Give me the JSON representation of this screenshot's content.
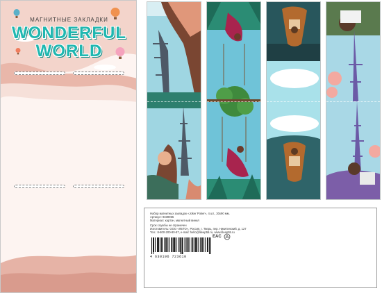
{
  "card": {
    "subtitle": "МАГНИТНЫЕ ЗАКЛАДКИ",
    "title_line1": "WONDERFUL",
    "title_line2": "WORLD",
    "colors": {
      "title": "#1fb7b0",
      "background": "#fdf4f1",
      "accent": "#e9b1a3"
    }
  },
  "bookmarks": [
    {
      "theme": "woman-eiffel-tower"
    },
    {
      "theme": "woman-on-swing"
    },
    {
      "theme": "rowing-boat-lake"
    },
    {
      "theme": "couple-picnic-eiffel-tower"
    }
  ],
  "label": {
    "line1": "Набор магнитных закладок «Joker Poker», 4 шт., 30х90 мм.",
    "line2": "Артикул: 9339955",
    "line3": "Материал: картон, магнитный винил",
    "line4": "Срок службы не ограничен",
    "line5": "Изготовитель: ООО «ЛЕТО», Россия, г. Тверь, пер. Никитинский, д. 127",
    "line6": "Тел.: 8-800-200-80-87, e-mail: hello@lileep55.ru, www.lileep55.ru",
    "barcode_number": "4 630196 723610",
    "cert_mark": "EAC"
  }
}
